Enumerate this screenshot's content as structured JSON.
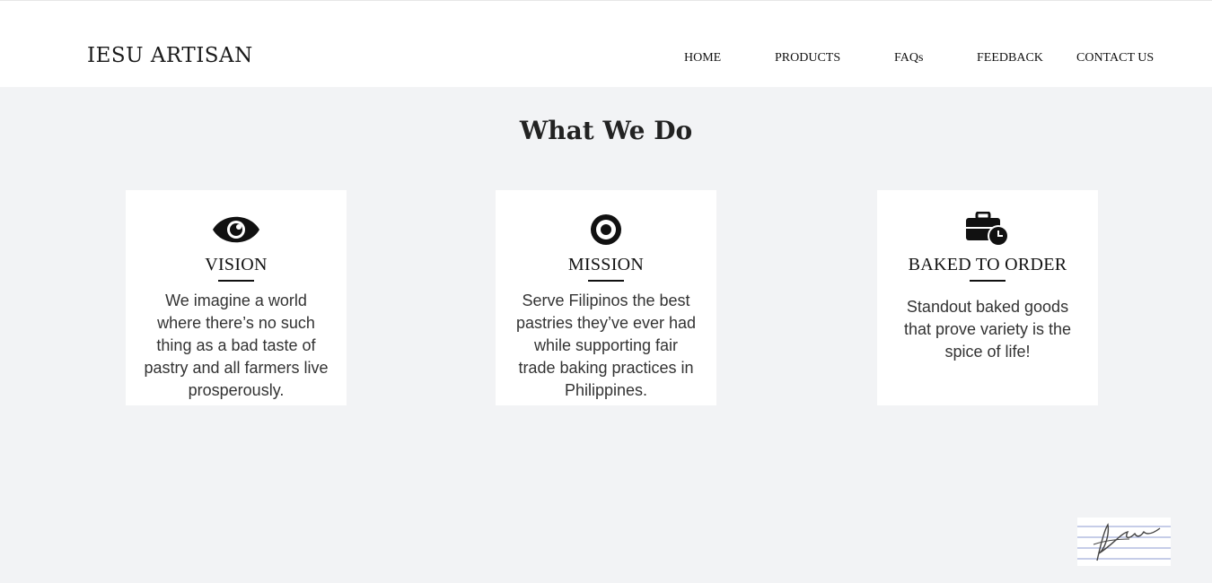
{
  "brand": "IESU ARTISAN",
  "nav": [
    {
      "label": "HOME"
    },
    {
      "label": "PRODUCTS"
    },
    {
      "label": "FAQs"
    },
    {
      "label": "FEEDBACK"
    },
    {
      "label": "CONTACT US"
    }
  ],
  "section_title": "What We Do",
  "cards": [
    {
      "icon": "eye-icon",
      "title": "VISION",
      "text": "We imagine a world where there’s no such thing as a bad taste of pastry and all farmers live prosperously."
    },
    {
      "icon": "target-icon",
      "title": "MISSION",
      "text": "Serve Filipinos the best pastries they’ve ever had while supporting fair trade baking practices in Philippines."
    },
    {
      "icon": "briefcase-clock-icon",
      "title": "BAKED TO ORDER",
      "text": "Standout baked goods that prove variety is the spice of life!"
    }
  ],
  "colors": {
    "background": "#f2f3f5",
    "header": "#ffffff",
    "card": "#ffffff",
    "text": "#1a1a1a"
  }
}
